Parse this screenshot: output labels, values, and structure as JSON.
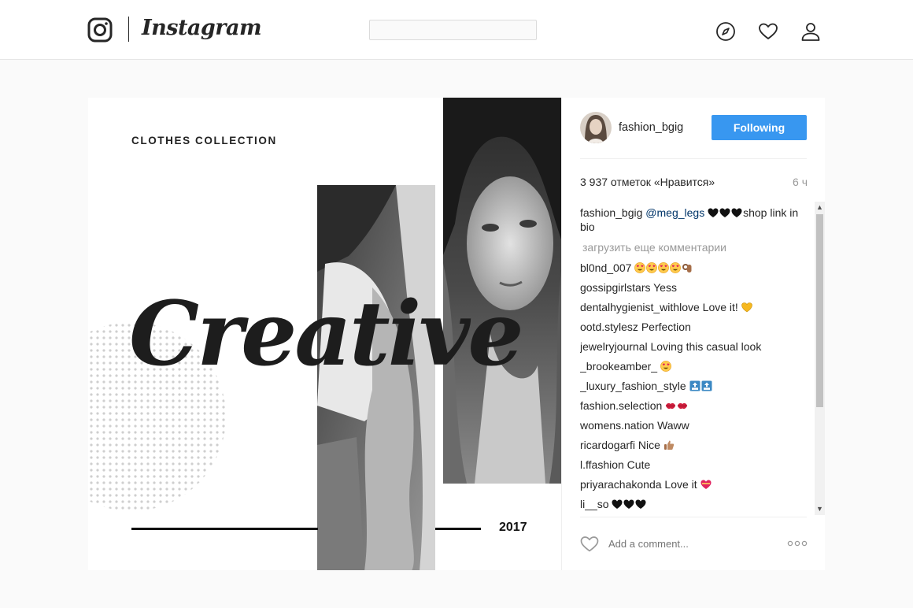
{
  "header": {
    "logo_word": "Instagram",
    "search_placeholder": "",
    "icons": [
      "instagram-logo-icon",
      "compass-icon",
      "heart-icon",
      "profile-icon"
    ]
  },
  "post": {
    "media": {
      "title": "CLOTHES COLLECTION",
      "script_word": "Creative",
      "year": "2017"
    },
    "author": {
      "username": "fashion_bgig",
      "follow_label": "Following"
    },
    "likes": "3 937 отметок «Нравится»",
    "time_ago": "6 ч",
    "caption": {
      "user": "fashion_bgig",
      "mention": "@meg_legs",
      "text": "shop link in bio",
      "emoji": [
        "black-heart",
        "black-heart",
        "black-heart"
      ]
    },
    "load_more": "загрузить еще комментарии",
    "comments": [
      {
        "user": "bl0nd_007",
        "text": "",
        "emoji": [
          "heart-eyes",
          "heart-eyes",
          "heart-eyes",
          "heart-eyes",
          "ok-hand"
        ]
      },
      {
        "user": "gossipgirlstars",
        "text": "Yess",
        "emoji": []
      },
      {
        "user": "dentalhygienist_withlove",
        "text": "Love it!",
        "emoji": [
          "yellow-heart"
        ]
      },
      {
        "user": "ootd.stylesz",
        "text": "Perfection",
        "emoji": []
      },
      {
        "user": "jewelryjournal",
        "text": "Loving this casual look",
        "emoji": []
      },
      {
        "user": "_brookeamber_",
        "text": "",
        "emoji": [
          "heart-eyes"
        ]
      },
      {
        "user": "_luxury_fashion_style",
        "text": "",
        "emoji": [
          "top-arrow",
          "top-arrow"
        ]
      },
      {
        "user": "fashion.selection",
        "text": "",
        "emoji": [
          "lips",
          "lips"
        ]
      },
      {
        "user": "womens.nation",
        "text": "Waww",
        "emoji": []
      },
      {
        "user": "ricardogarfi",
        "text": "Nice",
        "emoji": [
          "thumbs-up"
        ]
      },
      {
        "user": "l.ffashion",
        "text": "Cute",
        "emoji": []
      },
      {
        "user": "priyarachakonda",
        "text": "Love it",
        "emoji": [
          "heart-with-ribbon"
        ]
      },
      {
        "user": "li__so",
        "text": "",
        "emoji": [
          "black-heart",
          "black-heart",
          "black-heart"
        ]
      }
    ],
    "add_comment_placeholder": "Add a comment...",
    "colors": {
      "follow_button": "#3897f0",
      "mention": "#003569",
      "muted": "#999999"
    }
  }
}
